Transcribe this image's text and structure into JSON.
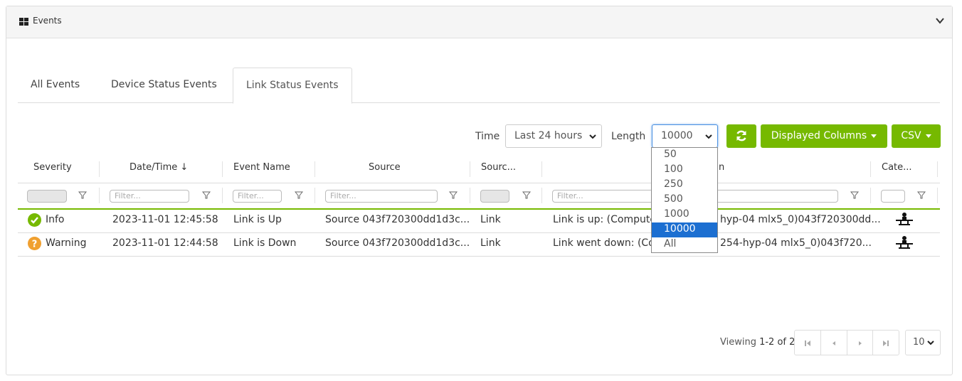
{
  "panel": {
    "title": "Events"
  },
  "tabs": [
    {
      "label": "All Events"
    },
    {
      "label": "Device Status Events"
    },
    {
      "label": "Link Status Events"
    }
  ],
  "toolbar": {
    "time_label": "Time",
    "time_value": "Last 24 hours",
    "length_label": "Length",
    "length_value": "10000",
    "displayed_columns_label": "Displayed Columns",
    "csv_label": "CSV"
  },
  "length_dropdown": {
    "options": [
      "50",
      "100",
      "250",
      "500",
      "1000",
      "10000",
      "All"
    ],
    "selected": "10000"
  },
  "columns": {
    "severity": "Severity",
    "datetime": "Date/Time ↓",
    "event_name": "Event Name",
    "source": "Source",
    "source_type": "Sourc...",
    "description_tail": "n",
    "category": "Cate..."
  },
  "filters": {
    "placeholder": "Filter..."
  },
  "rows": [
    {
      "severity": "Info",
      "datetime": "2023-11-01 12:45:58",
      "event_name": "Link is Up",
      "source": "Source 043f720300dd1d3c...",
      "source_type": "Link",
      "description_left": "Link is up: (Compute",
      "description_right": "hyp-04 mlx5_0)043f720300dd..."
    },
    {
      "severity": "Warning",
      "datetime": "2023-11-01 12:44:58",
      "event_name": "Link is Down",
      "source": "Source 043f720300dd1d3c...",
      "source_type": "Link",
      "description_left": "Link went down: (Co",
      "description_right": "254-hyp-04 mlx5_0)043f720..."
    }
  ],
  "pager": {
    "viewing_prefix": "Viewing ",
    "viewing_range": "1-2 of 2",
    "page_size": "10"
  },
  "colors": {
    "accent_green": "#76b900",
    "info_green": "#76b900",
    "warning_orange": "#f0a030",
    "selected_blue": "#1c6fd1"
  },
  "icons": {
    "panel": "grid-icon",
    "collapse": "chevron-down-icon",
    "refresh": "refresh-icon",
    "info": "check-circle-icon",
    "warning": "question-circle-icon",
    "category": "network-node-icon"
  }
}
